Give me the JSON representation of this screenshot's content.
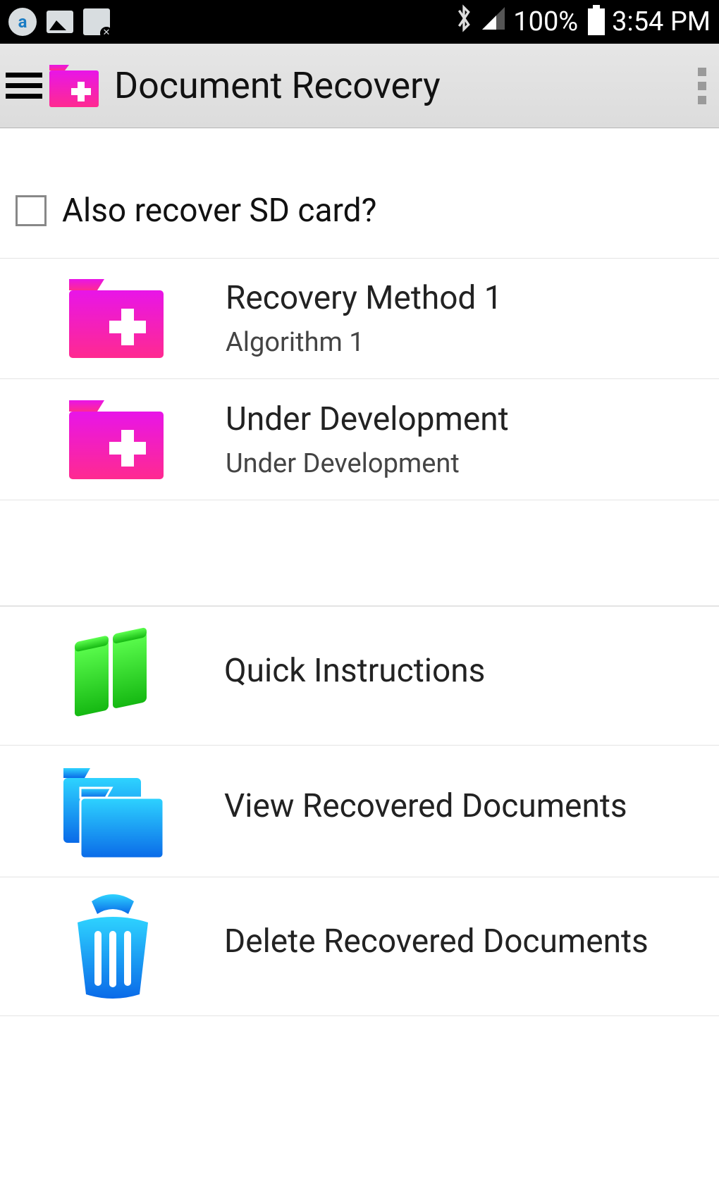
{
  "status": {
    "battery": "100%",
    "time": "3:54 PM"
  },
  "appbar": {
    "title": "Document Recovery"
  },
  "checkbox": {
    "label": "Also recover SD card?",
    "checked": false
  },
  "methods": [
    {
      "title": "Recovery Method 1",
      "subtitle": "Algorithm 1"
    },
    {
      "title": "Under Development",
      "subtitle": "Under Development"
    }
  ],
  "actions": [
    {
      "title": "Quick Instructions"
    },
    {
      "title": "View Recovered Documents"
    },
    {
      "title": "Delete Recovered Documents"
    }
  ]
}
